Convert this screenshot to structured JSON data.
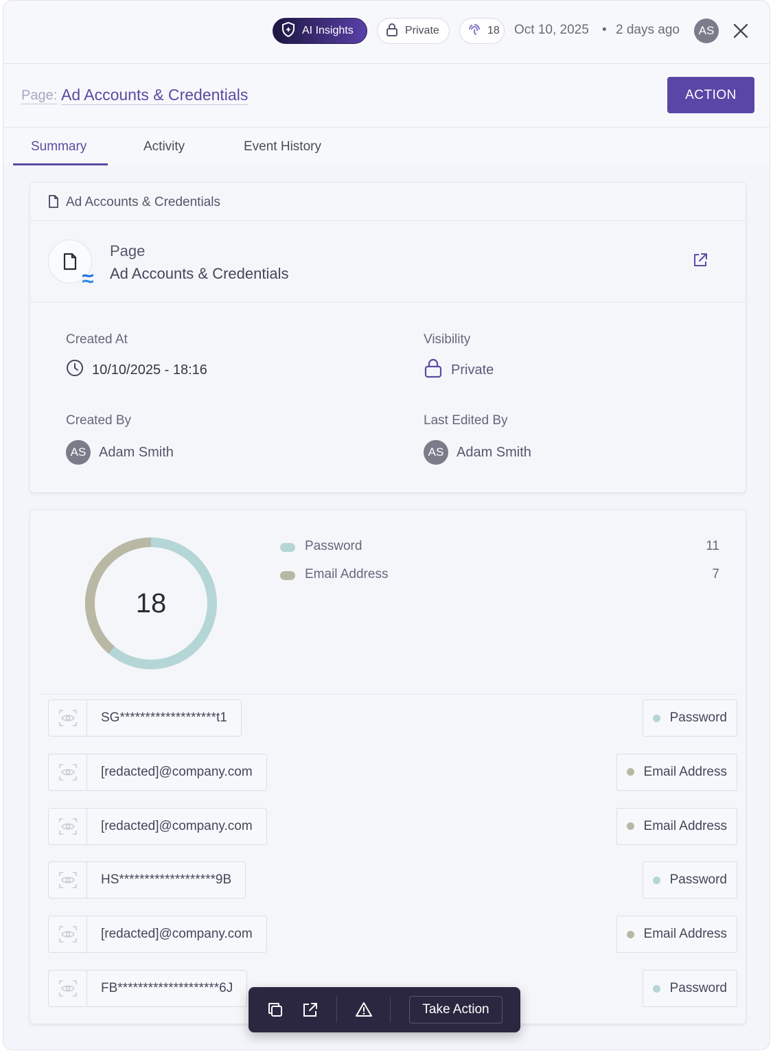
{
  "topbar": {
    "ai_insights_label": "AI Insights",
    "visibility_label": "Private",
    "findings_count": "18",
    "date": "Oct 10, 2025",
    "separator": "•",
    "relative_time": "2 days ago",
    "avatar_initials": "AS"
  },
  "header": {
    "prefix": "Page:",
    "title": "Ad Accounts & Credentials",
    "action_label": "ACTION"
  },
  "tabs": [
    {
      "label": "Summary",
      "active": true
    },
    {
      "label": "Activity",
      "active": false
    },
    {
      "label": "Event History",
      "active": false
    }
  ],
  "details": {
    "card_title": "Ad Accounts & Credentials",
    "page_type": "Page",
    "page_name": "Ad Accounts & Credentials",
    "created_at_label": "Created At",
    "created_at_value": "10/10/2025 - 18:16",
    "visibility_label": "Visibility",
    "visibility_value": "Private",
    "created_by_label": "Created By",
    "created_by_initials": "AS",
    "created_by_name": "Adam Smith",
    "last_edited_label": "Last Edited By",
    "last_edited_initials": "AS",
    "last_edited_name": "Adam Smith"
  },
  "chart_data": {
    "type": "pie",
    "title": "",
    "total": "18",
    "series": [
      {
        "name": "Password",
        "value": 11,
        "color": "#b5d6d6"
      },
      {
        "name": "Email Address",
        "value": 7,
        "color": "#b8b8a4"
      }
    ]
  },
  "findings": [
    {
      "value": "SG*******************t1",
      "type": "Password",
      "dot_color": "#b5d6d6"
    },
    {
      "value": "[redacted]@company.com",
      "type": "Email Address",
      "dot_color": "#b8b8a4"
    },
    {
      "value": "[redacted]@company.com",
      "type": "Email Address",
      "dot_color": "#b8b8a4"
    },
    {
      "value": "HS*******************9B",
      "type": "Password",
      "dot_color": "#b5d6d6"
    },
    {
      "value": "[redacted]@company.com",
      "type": "Email Address",
      "dot_color": "#b8b8a4"
    },
    {
      "value": "FB********************6J",
      "type": "Password",
      "dot_color": "#b5d6d6"
    }
  ],
  "toolbar": {
    "take_action_label": "Take Action"
  },
  "colors": {
    "accent": "#5a46a6",
    "password": "#b5d6d6",
    "email": "#b8b8a4",
    "toolbar_bg": "#2b2740"
  }
}
